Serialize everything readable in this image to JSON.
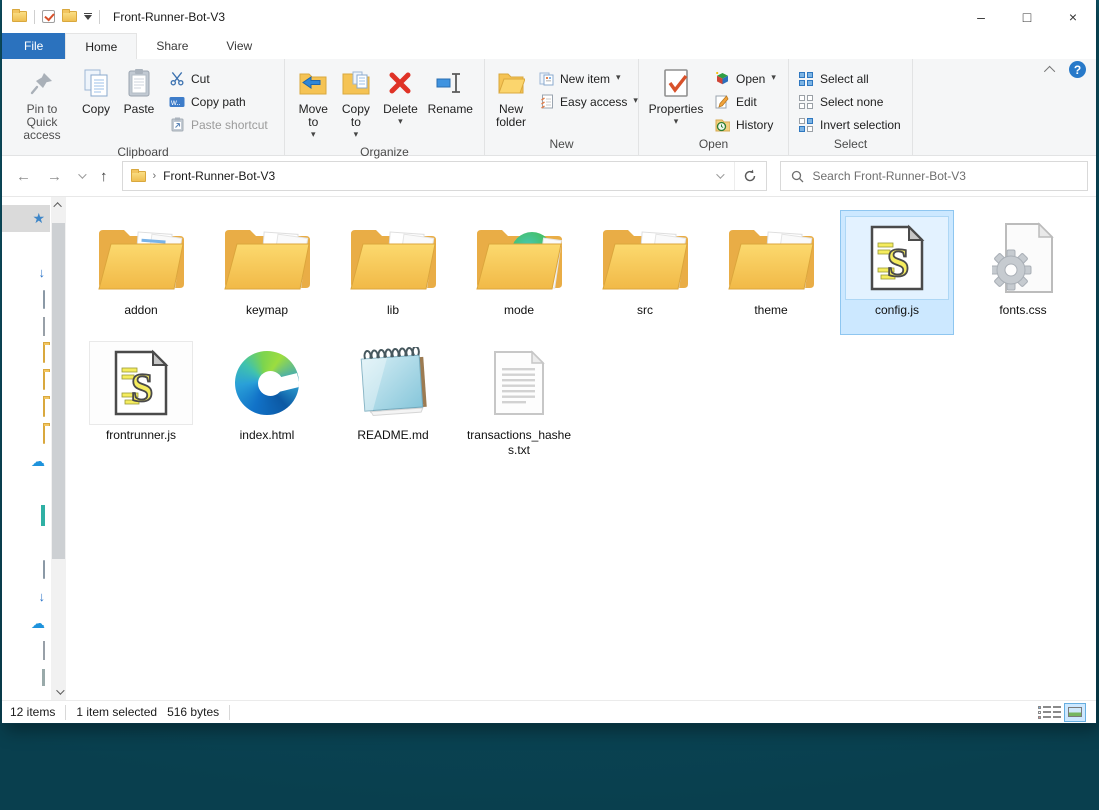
{
  "window": {
    "title": "Front-Runner-Bot-V3",
    "caption": {
      "minimize": "–",
      "maximize": "□",
      "close": "×"
    },
    "qat_icons": [
      "folder-icon",
      "properties-checkbox-icon",
      "folder-icon",
      "customize-caret-icon"
    ]
  },
  "tabs": {
    "file": "File",
    "home": "Home",
    "share": "Share",
    "view": "View"
  },
  "ribbon": {
    "help_glyph": "?",
    "clipboard": {
      "caption": "Clipboard",
      "pin": "Pin to Quick access",
      "copy": "Copy",
      "paste": "Paste",
      "cut": "Cut",
      "copy_path": "Copy path",
      "paste_shortcut": "Paste shortcut"
    },
    "organize": {
      "caption": "Organize",
      "move_to": "Move to",
      "copy_to": "Copy to",
      "del": "Delete",
      "rename": "Rename"
    },
    "new_group": {
      "caption": "New",
      "new_folder": "New folder",
      "new_item": "New item",
      "easy_access": "Easy access"
    },
    "open_group": {
      "caption": "Open",
      "properties": "Properties",
      "open": "Open",
      "edit": "Edit",
      "history": "History"
    },
    "select_group": {
      "caption": "Select",
      "select_all": "Select all",
      "select_none": "Select none",
      "invert": "Invert selection"
    }
  },
  "address": {
    "breadcrumb_separator": "›",
    "path": "Front-Runner-Bot-V3",
    "icons": [
      "back-arrow",
      "forward-arrow",
      "recent-locations-chevron",
      "up-arrow",
      "address-dropdown-chevron",
      "refresh-icon"
    ]
  },
  "search": {
    "placeholder": "Search Front-Runner-Bot-V3"
  },
  "files": [
    {
      "name": "addon",
      "icon": "folder-addon",
      "selected": false
    },
    {
      "name": "keymap",
      "icon": "folder-js",
      "selected": false
    },
    {
      "name": "lib",
      "icon": "folder-doc",
      "selected": false
    },
    {
      "name": "mode",
      "icon": "folder-globe",
      "selected": false
    },
    {
      "name": "src",
      "icon": "folder-js",
      "selected": false
    },
    {
      "name": "theme",
      "icon": "folder-doc",
      "selected": false
    },
    {
      "name": "config.js",
      "icon": "js-script-file",
      "selected": true
    },
    {
      "name": "fonts.css",
      "icon": "css-gear-file",
      "selected": false
    },
    {
      "name": "frontrunner.js",
      "icon": "js-script-file",
      "selected": false,
      "hovered": true
    },
    {
      "name": "index.html",
      "icon": "edge-browser",
      "selected": false
    },
    {
      "name": "README.md",
      "icon": "notepad",
      "selected": false
    },
    {
      "name": "transactions_hashes.txt",
      "icon": "text-file",
      "selected": false
    }
  ],
  "sidebar": {
    "items": [
      {
        "icon": "quick-access-star",
        "active": true
      },
      {
        "icon": "monitor"
      },
      {
        "icon": "down-arrow"
      },
      {
        "icon": "document"
      },
      {
        "icon": "picture"
      },
      {
        "icon": "folder"
      },
      {
        "icon": "folder"
      },
      {
        "icon": "folder"
      },
      {
        "icon": "folder"
      },
      {
        "icon": "onedrive-cloud"
      },
      {
        "icon": "monitor"
      },
      {
        "icon": "box-3d"
      },
      {
        "icon": "monitor"
      },
      {
        "icon": "document"
      },
      {
        "icon": "down-arrow"
      },
      {
        "icon": "onedrive-cloud"
      },
      {
        "icon": "picture"
      },
      {
        "icon": "film"
      }
    ]
  },
  "status": {
    "item_count": "12 items",
    "selection": "1 item selected",
    "selection_size": "516 bytes",
    "view_toggles": [
      "details-view-icon",
      "thumbnail-view-icon"
    ]
  }
}
